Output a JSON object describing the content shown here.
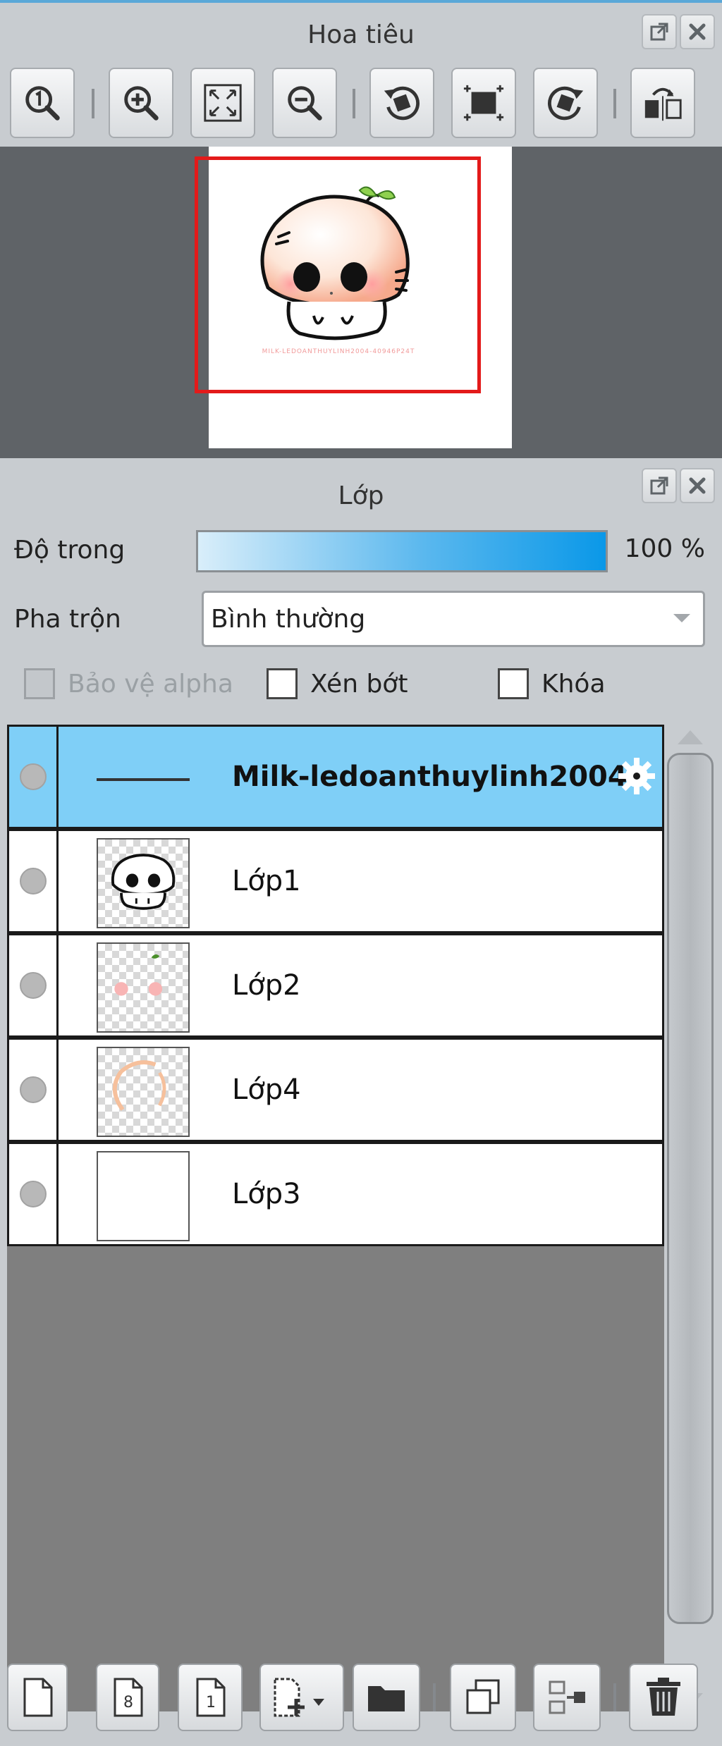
{
  "navigator": {
    "title": "Hoa tiêu",
    "title_buttons": [
      "float-icon",
      "close-icon"
    ],
    "toolbar": [
      "zoom-actual-icon",
      "zoom-in-icon",
      "fit-window-icon",
      "zoom-out-icon",
      "rotate-left-icon",
      "reset-rotation-icon",
      "rotate-right-icon",
      "flip-horizontal-icon"
    ],
    "preview": {
      "caption": "MILK-LEDOANTHUYLINH2004-40946P24T",
      "view_rect_color": "#e31a1a"
    }
  },
  "layers": {
    "title": "Lớp",
    "opacity_label": "Độ trong",
    "opacity_value": "100 %",
    "opacity": 1.0,
    "blend_label": "Pha trộn",
    "blend_value": "Bình thường",
    "protect_alpha_label": "Bảo vệ alpha",
    "clip_label": "Xén bớt",
    "lock_label": "Khóa",
    "list": [
      {
        "name": "Milk-ledoanthuylinh2004",
        "selected": true,
        "thumb": "line"
      },
      {
        "name": "Lớp1",
        "selected": false,
        "thumb": "face"
      },
      {
        "name": "Lớp2",
        "selected": false,
        "thumb": "cheeks"
      },
      {
        "name": "Lớp4",
        "selected": false,
        "thumb": "outline"
      },
      {
        "name": "Lớp3",
        "selected": false,
        "thumb": "white"
      }
    ],
    "toolbar": [
      "new-layer-icon",
      "new-8bit-layer-icon",
      "new-1bit-layer-icon",
      "add-layer-dropdown-icon",
      "folder-icon",
      "duplicate-layer-icon",
      "merge-down-icon",
      "delete-icon"
    ],
    "selection_color": "#7fcff7"
  }
}
